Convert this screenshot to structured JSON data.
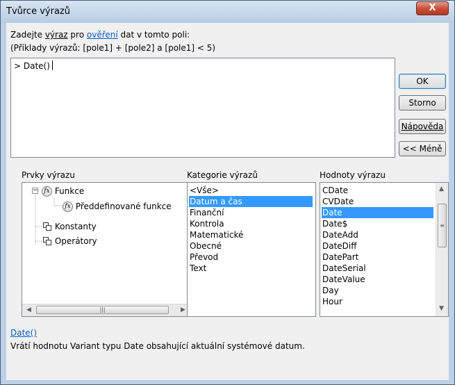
{
  "window": {
    "title": "Tvůrce výrazů",
    "close_symbol": "X"
  },
  "instructions": {
    "prefix": "Zadejte ",
    "word_vyraz": "výraz",
    "middle": " pro ",
    "link": "ověření",
    "suffix": " dat v tomto poli:",
    "examples": "(Příklady výrazů: [pole1] + [pole2] a [pole1] < 5)"
  },
  "expression": {
    "value": "> Date()"
  },
  "buttons": {
    "ok": "OK",
    "cancel": "Storno",
    "help": "Nápověda",
    "less": "<< Méně"
  },
  "panels": {
    "elements_label": "Prvky výrazu",
    "categories_label": "Kategorie výrazů",
    "values_label": "Hodnoty výrazu"
  },
  "tree": {
    "items": [
      {
        "label": "Funkce",
        "icon": "fx-icon",
        "expander": "−"
      },
      {
        "label": "Předdefinované funkce",
        "icon": "fx-icon",
        "selected": true
      },
      {
        "label": "Konstanty",
        "icon": "constants-icon",
        "expander": "+"
      },
      {
        "label": "Operátory",
        "icon": "operators-icon",
        "expander": "+"
      }
    ]
  },
  "categories": {
    "items": [
      "<Vše>",
      "Datum a čas",
      "Finanční",
      "Kontrola",
      "Matematické",
      "Obecné",
      "Převod",
      "Text"
    ],
    "selected_index": 1
  },
  "values": {
    "items": [
      "CDate",
      "CVDate",
      "Date",
      "Date$",
      "DateAdd",
      "DateDiff",
      "DatePart",
      "DateSerial",
      "DateValue",
      "Day",
      "Hour"
    ],
    "selected_index": 2
  },
  "description": {
    "function": "Date()",
    "text": "Vrátí hodnotu Variant typu Date obsahující aktuální systémové datum."
  },
  "colors": {
    "selection": "#3399ff",
    "link": "#0a5bc4"
  }
}
